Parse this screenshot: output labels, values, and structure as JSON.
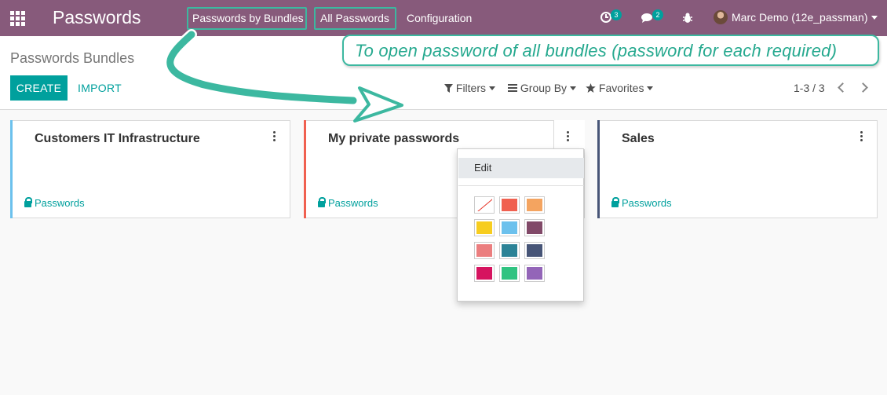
{
  "navbar": {
    "app_title": "Passwords",
    "menu": [
      {
        "label": "Passwords by Bundles"
      },
      {
        "label": "All Passwords"
      },
      {
        "label": "Configuration"
      }
    ],
    "activity_count": "3",
    "messages_count": "2",
    "user_name": "Marc Demo (12e_passman)"
  },
  "annotation": {
    "text": "To open password of all bundles (password for each required)"
  },
  "control_panel": {
    "breadcrumb": "Passwords Bundles",
    "create_label": "CREATE",
    "import_label": "IMPORT",
    "filters_label": "Filters",
    "groupby_label": "Group By",
    "favorites_label": "Favorites",
    "pager": "1-3 / 3"
  },
  "kanban": {
    "cards": [
      {
        "title": "Customers IT Infrastructure",
        "link": "Passwords",
        "color": "#6cc1ed"
      },
      {
        "title": "My private passwords",
        "link": "Passwords",
        "color": "#f06050"
      },
      {
        "title": "Sales",
        "link": "Passwords",
        "color": "#475577"
      }
    ]
  },
  "dropdown": {
    "edit_label": "Edit",
    "colors": [
      "#ffffff",
      "#f06050",
      "#f4a460",
      "#f7cd1f",
      "#6cc1ed",
      "#814968",
      "#eb7e7f",
      "#2c8397",
      "#475577",
      "#d6145f",
      "#30c381",
      "#9365b8"
    ]
  },
  "theme": {
    "navbar": "#875a7b",
    "primary": "#00a09d",
    "annotation": "#3cb8a0"
  }
}
